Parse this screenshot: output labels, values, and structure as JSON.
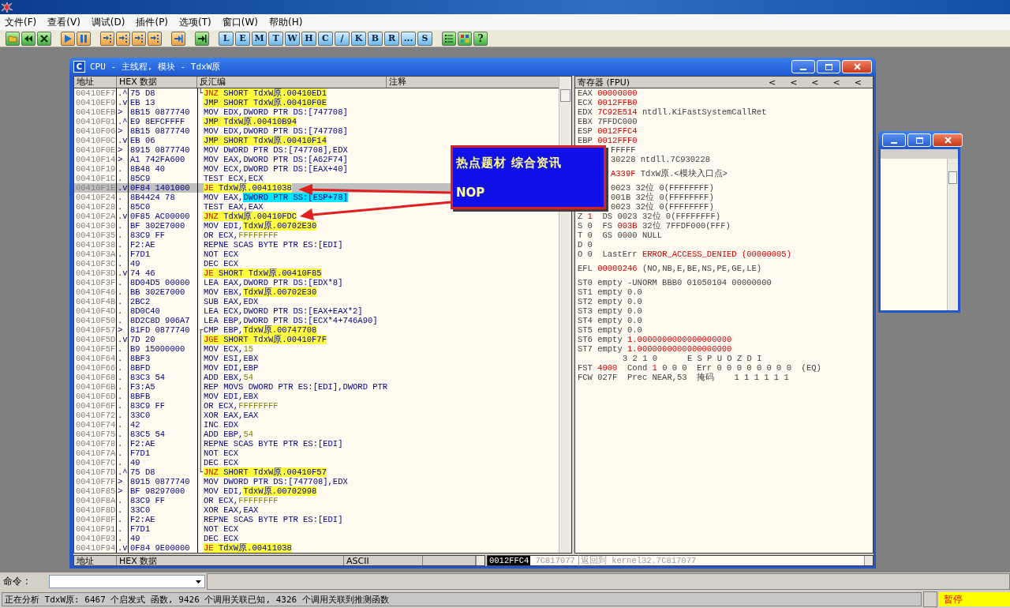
{
  "menu": [
    "文件(F)",
    "查看(V)",
    "调试(D)",
    "插件(P)",
    "选项(T)",
    "窗口(W)",
    "帮助(H)"
  ],
  "toolbar": {
    "letters": [
      "L",
      "E",
      "M",
      "T",
      "W",
      "H",
      "C",
      "/",
      "K",
      "B",
      "R",
      "...",
      "S"
    ],
    "help": "?"
  },
  "cpu_window": {
    "title": "CPU - 主线程, 模块 - TdxW原",
    "icon_letter": "C"
  },
  "disasm": {
    "columns": [
      "地址",
      "HEX 数据",
      "反汇编",
      "注释"
    ],
    "rows": [
      {
        "address": "00410EF7",
        "mark": ".^",
        "hex": "75 D8",
        "mnemonic": "JNZ",
        "kind": "jcc",
        "operands": [
          {
            "text": "SHORT TdxW原.00410ED1",
            "kind": "addr"
          }
        ],
        "selected": false,
        "bracket": "└"
      },
      {
        "address": "00410EF9",
        "mark": ".v",
        "hex": "EB 13",
        "mnemonic": "JMP",
        "kind": "jmp",
        "operands": [
          {
            "text": "SHORT TdxW原.00410F0E",
            "kind": "addr"
          }
        ],
        "selected": false
      },
      {
        "address": "00410EFB",
        "mark": ">",
        "hex": "8B15 0877740",
        "mnemonic": "MOV",
        "kind": "plain",
        "operands": [
          {
            "text": "EDX,DWORD PTR DS:[747708]",
            "kind": "plain"
          }
        ],
        "selected": false
      },
      {
        "address": "00410F01",
        "mark": ".^",
        "hex": "E9 8EFCFFFF",
        "mnemonic": "JMP",
        "kind": "jmp",
        "operands": [
          {
            "text": "TdxW原.00410B94",
            "kind": "addr"
          }
        ],
        "selected": false
      },
      {
        "address": "00410F06",
        "mark": ">",
        "hex": "8B15 0877740",
        "mnemonic": "MOV",
        "kind": "plain",
        "operands": [
          {
            "text": "EDX,DWORD PTR DS:[747708]",
            "kind": "plain"
          }
        ],
        "selected": false
      },
      {
        "address": "00410F0C",
        "mark": ".v",
        "hex": "EB 06",
        "mnemonic": "JMP",
        "kind": "jmp",
        "operands": [
          {
            "text": "SHORT TdxW原.00410F14",
            "kind": "addr"
          }
        ],
        "selected": false
      },
      {
        "address": "00410F0E",
        "mark": ">",
        "hex": "8915 0877740",
        "mnemonic": "MOV",
        "kind": "plain",
        "operands": [
          {
            "text": "DWORD PTR DS:[747708],EDX",
            "kind": "plain"
          }
        ],
        "selected": false
      },
      {
        "address": "00410F14",
        "mark": ">",
        "hex": "A1 742FA600",
        "mnemonic": "MOV",
        "kind": "plain",
        "operands": [
          {
            "text": "EAX,DWORD PTR DS:[A62F74]",
            "kind": "plain"
          }
        ],
        "selected": false
      },
      {
        "address": "00410F19",
        "mark": ".",
        "hex": "8B48 40",
        "mnemonic": "MOV",
        "kind": "plain",
        "operands": [
          {
            "text": "ECX,DWORD PTR DS:[EAX+40]",
            "kind": "plain"
          }
        ],
        "selected": false
      },
      {
        "address": "00410F1C",
        "mark": ".",
        "hex": "85C9",
        "mnemonic": "TEST",
        "kind": "plain",
        "operands": [
          {
            "text": "ECX,ECX",
            "kind": "plain"
          }
        ],
        "selected": false
      },
      {
        "address": "00410F1E",
        "mark": ".v",
        "hex": "0F84 1401000",
        "mnemonic": "JE",
        "kind": "jcc",
        "operands": [
          {
            "text": "TdxW原.00411038",
            "kind": "addr"
          }
        ],
        "selected": true
      },
      {
        "address": "00410F24",
        "mark": ".",
        "hex": "8B4424 78",
        "mnemonic": "MOV",
        "kind": "plain",
        "operands": [
          {
            "text": "EAX,",
            "kind": "plain"
          },
          {
            "text": "DWORD PTR SS:[ESP+78]",
            "kind": "stack"
          }
        ],
        "selected": false
      },
      {
        "address": "00410F28",
        "mark": ".",
        "hex": "85C0",
        "mnemonic": "TEST",
        "kind": "plain",
        "operands": [
          {
            "text": "EAX,EAX",
            "kind": "plain"
          }
        ],
        "selected": false
      },
      {
        "address": "00410F2A",
        "mark": ".v",
        "hex": "0F85 AC00000",
        "mnemonic": "JNZ",
        "kind": "jcc",
        "operands": [
          {
            "text": "TdxW原.00410FDC",
            "kind": "addr"
          }
        ],
        "selected": false
      },
      {
        "address": "00410F30",
        "mark": ".",
        "hex": "BF 302E7000",
        "mnemonic": "MOV",
        "kind": "plain",
        "operands": [
          {
            "text": "EDI,",
            "kind": "plain"
          },
          {
            "text": "TdxW原.00702E30",
            "kind": "addr"
          }
        ],
        "selected": false
      },
      {
        "address": "00410F35",
        "mark": ".",
        "hex": "83C9 FF",
        "mnemonic": "OR",
        "kind": "plain",
        "operands": [
          {
            "text": "ECX,",
            "kind": "plain"
          },
          {
            "text": "FFFFFFFF",
            "kind": "const"
          }
        ],
        "selected": false
      },
      {
        "address": "00410F38",
        "mark": ".",
        "hex": "F2:AE",
        "mnemonic": "REPNE",
        "kind": "plain",
        "operands": [
          {
            "text": "SCAS BYTE PTR ES:[EDI]",
            "kind": "plain"
          }
        ],
        "selected": false
      },
      {
        "address": "00410F3A",
        "mark": ".",
        "hex": "F7D1",
        "mnemonic": "NOT",
        "kind": "plain",
        "operands": [
          {
            "text": "ECX",
            "kind": "plain"
          }
        ],
        "selected": false
      },
      {
        "address": "00410F3C",
        "mark": ".",
        "hex": "49",
        "mnemonic": "DEC",
        "kind": "plain",
        "operands": [
          {
            "text": "ECX",
            "kind": "plain"
          }
        ],
        "selected": false
      },
      {
        "address": "00410F3D",
        "mark": ".v",
        "hex": "74 46",
        "mnemonic": "JE",
        "kind": "jcc",
        "operands": [
          {
            "text": "SHORT TdxW原.00410F85",
            "kind": "addr"
          }
        ],
        "selected": false
      },
      {
        "address": "00410F3F",
        "mark": ".",
        "hex": "8D04D5 00000",
        "mnemonic": "LEA",
        "kind": "plain",
        "operands": [
          {
            "text": "EAX,DWORD PTR DS:[EDX*8]",
            "kind": "plain"
          }
        ],
        "selected": false
      },
      {
        "address": "00410F46",
        "mark": ".",
        "hex": "BB 302E7000",
        "mnemonic": "MOV",
        "kind": "plain",
        "operands": [
          {
            "text": "EBX,",
            "kind": "plain"
          },
          {
            "text": "TdxW原.00702E30",
            "kind": "addr"
          }
        ],
        "selected": false
      },
      {
        "address": "00410F4B",
        "mark": ".",
        "hex": "2BC2",
        "mnemonic": "SUB",
        "kind": "plain",
        "operands": [
          {
            "text": "EAX,EDX",
            "kind": "plain"
          }
        ],
        "selected": false
      },
      {
        "address": "00410F4D",
        "mark": ".",
        "hex": "8D0C40",
        "mnemonic": "LEA",
        "kind": "plain",
        "operands": [
          {
            "text": "ECX,DWORD PTR DS:[EAX+EAX*2]",
            "kind": "plain"
          }
        ],
        "selected": false
      },
      {
        "address": "00410F50",
        "mark": ".",
        "hex": "8D2C8D 906A7",
        "mnemonic": "LEA",
        "kind": "plain",
        "operands": [
          {
            "text": "EBP,DWORD PTR DS:[ECX*4+746A90]",
            "kind": "plain"
          }
        ],
        "selected": false
      },
      {
        "address": "00410F57",
        "mark": ">",
        "hex": "81FD 0877740",
        "mnemonic": "CMP",
        "kind": "plain",
        "operands": [
          {
            "text": "EBP,",
            "kind": "plain"
          },
          {
            "text": "TdxW原.00747708",
            "kind": "addr"
          }
        ],
        "selected": false,
        "bracket": "┌"
      },
      {
        "address": "00410F5D",
        "mark": ".v",
        "hex": "7D 20",
        "mnemonic": "JGE",
        "kind": "jcc",
        "operands": [
          {
            "text": "SHORT TdxW原.00410F7F",
            "kind": "addr"
          }
        ],
        "selected": false,
        "bracket": "│"
      },
      {
        "address": "00410F5F",
        "mark": ".",
        "hex": "B9 15000000",
        "mnemonic": "MOV",
        "kind": "plain",
        "operands": [
          {
            "text": "ECX,",
            "kind": "plain"
          },
          {
            "text": "15",
            "kind": "const"
          }
        ],
        "selected": false,
        "bracket": "│"
      },
      {
        "address": "00410F64",
        "mark": ".",
        "hex": "8BF3",
        "mnemonic": "MOV",
        "kind": "plain",
        "operands": [
          {
            "text": "ESI,EBX",
            "kind": "plain"
          }
        ],
        "selected": false,
        "bracket": "│"
      },
      {
        "address": "00410F66",
        "mark": ".",
        "hex": "8BFD",
        "mnemonic": "MOV",
        "kind": "plain",
        "operands": [
          {
            "text": "EDI,EBP",
            "kind": "plain"
          }
        ],
        "selected": false,
        "bracket": "│"
      },
      {
        "address": "00410F68",
        "mark": ".",
        "hex": "83C3 54",
        "mnemonic": "ADD",
        "kind": "plain",
        "operands": [
          {
            "text": "EBX,",
            "kind": "plain"
          },
          {
            "text": "54",
            "kind": "const"
          }
        ],
        "selected": false,
        "bracket": "│"
      },
      {
        "address": "00410F6B",
        "mark": ".",
        "hex": "F3:A5",
        "mnemonic": "REP",
        "kind": "plain",
        "operands": [
          {
            "text": "MOVS DWORD PTR ES:[EDI],DWORD PTR",
            "kind": "plain"
          }
        ],
        "selected": false,
        "bracket": "│"
      },
      {
        "address": "00410F6D",
        "mark": ".",
        "hex": "8BFB",
        "mnemonic": "MOV",
        "kind": "plain",
        "operands": [
          {
            "text": "EDI,EBX",
            "kind": "plain"
          }
        ],
        "selected": false,
        "bracket": "│"
      },
      {
        "address": "00410F6F",
        "mark": ".",
        "hex": "83C9 FF",
        "mnemonic": "OR",
        "kind": "plain",
        "operands": [
          {
            "text": "ECX,",
            "kind": "plain"
          },
          {
            "text": "FFFFFFFF",
            "kind": "const"
          }
        ],
        "selected": false,
        "bracket": "│"
      },
      {
        "address": "00410F72",
        "mark": ".",
        "hex": "33C0",
        "mnemonic": "XOR",
        "kind": "plain",
        "operands": [
          {
            "text": "EAX,EAX",
            "kind": "plain"
          }
        ],
        "selected": false,
        "bracket": "│"
      },
      {
        "address": "00410F74",
        "mark": ".",
        "hex": "42",
        "mnemonic": "INC",
        "kind": "plain",
        "operands": [
          {
            "text": "EDX",
            "kind": "plain"
          }
        ],
        "selected": false,
        "bracket": "│"
      },
      {
        "address": "00410F75",
        "mark": ".",
        "hex": "83C5 54",
        "mnemonic": "ADD",
        "kind": "plain",
        "operands": [
          {
            "text": "EBP,",
            "kind": "plain"
          },
          {
            "text": "54",
            "kind": "const"
          }
        ],
        "selected": false,
        "bracket": "│"
      },
      {
        "address": "00410F78",
        "mark": ".",
        "hex": "F2:AE",
        "mnemonic": "REPNE",
        "kind": "plain",
        "operands": [
          {
            "text": "SCAS BYTE PTR ES:[EDI]",
            "kind": "plain"
          }
        ],
        "selected": false,
        "bracket": "│"
      },
      {
        "address": "00410F7A",
        "mark": ".",
        "hex": "F7D1",
        "mnemonic": "NOT",
        "kind": "plain",
        "operands": [
          {
            "text": "ECX",
            "kind": "plain"
          }
        ],
        "selected": false,
        "bracket": "│"
      },
      {
        "address": "00410F7C",
        "mark": ".",
        "hex": "49",
        "mnemonic": "DEC",
        "kind": "plain",
        "operands": [
          {
            "text": "ECX",
            "kind": "plain"
          }
        ],
        "selected": false,
        "bracket": "│"
      },
      {
        "address": "00410F7D",
        "mark": ".^",
        "hex": "75 D8",
        "mnemonic": "JNZ",
        "kind": "jcc",
        "operands": [
          {
            "text": "SHORT TdxW原.00410F57",
            "kind": "addr"
          }
        ],
        "selected": false,
        "bracket": "└"
      },
      {
        "address": "00410F7F",
        "mark": ">",
        "hex": "8915 0877740",
        "mnemonic": "MOV",
        "kind": "plain",
        "operands": [
          {
            "text": "DWORD PTR DS:[747708],EDX",
            "kind": "plain"
          }
        ],
        "selected": false
      },
      {
        "address": "00410F85",
        "mark": ">",
        "hex": "BF 98297000",
        "mnemonic": "MOV",
        "kind": "plain",
        "operands": [
          {
            "text": "EDI,",
            "kind": "plain"
          },
          {
            "text": "TdxW原.00702998",
            "kind": "addr"
          }
        ],
        "selected": false
      },
      {
        "address": "00410F8A",
        "mark": ".",
        "hex": "83C9 FF",
        "mnemonic": "OR",
        "kind": "plain",
        "operands": [
          {
            "text": "ECX,",
            "kind": "plain"
          },
          {
            "text": "FFFFFFFF",
            "kind": "const"
          }
        ],
        "selected": false
      },
      {
        "address": "00410F8D",
        "mark": ".",
        "hex": "33C0",
        "mnemonic": "XOR",
        "kind": "plain",
        "operands": [
          {
            "text": "EAX,EAX",
            "kind": "plain"
          }
        ],
        "selected": false
      },
      {
        "address": "00410F8F",
        "mark": ".",
        "hex": "F2:AE",
        "mnemonic": "REPNE",
        "kind": "plain",
        "operands": [
          {
            "text": "SCAS BYTE PTR ES:[EDI]",
            "kind": "plain"
          }
        ],
        "selected": false
      },
      {
        "address": "00410F91",
        "mark": ".",
        "hex": "F7D1",
        "mnemonic": "NOT",
        "kind": "plain",
        "operands": [
          {
            "text": "ECX",
            "kind": "plain"
          }
        ],
        "selected": false
      },
      {
        "address": "00410F93",
        "mark": ".",
        "hex": "49",
        "mnemonic": "DEC",
        "kind": "plain",
        "operands": [
          {
            "text": "ECX",
            "kind": "plain"
          }
        ],
        "selected": false
      },
      {
        "address": "00410F94",
        "mark": ".v",
        "hex": "0F84 9E00000",
        "mnemonic": "JE",
        "kind": "jcc",
        "operands": [
          {
            "text": "TdxW原.00411038",
            "kind": "addr"
          }
        ],
        "selected": false
      }
    ]
  },
  "registers": {
    "title": "寄存器 (FPU)",
    "arrows": [
      "<",
      "<",
      "<",
      "<",
      "<"
    ],
    "groups": [
      {
        "lines": [
          {
            "kind": "full",
            "parts": [
              {
                "text": "EAX ",
                "changed": false
              },
              {
                "text": "00000000",
                "changed": true
              }
            ]
          },
          {
            "kind": "full",
            "parts": [
              {
                "text": "ECX ",
                "changed": false
              },
              {
                "text": "0012FFB0",
                "changed": true
              }
            ]
          },
          {
            "kind": "full",
            "parts": [
              {
                "text": "EDX ",
                "changed": false
              },
              {
                "text": "7C92E514",
                "changed": true
              },
              {
                "text": " ntdll.KiFastSystemCallRet",
                "changed": false
              }
            ]
          },
          {
            "kind": "full",
            "parts": [
              {
                "text": "EBX 7FFDC000",
                "changed": false
              }
            ]
          },
          {
            "kind": "full",
            "parts": [
              {
                "text": "ESP ",
                "changed": false
              },
              {
                "text": "0012FFC4",
                "changed": true
              }
            ]
          },
          {
            "kind": "full",
            "parts": [
              {
                "text": "EBP ",
                "changed": false
              },
              {
                "text": "0012FFF0",
                "changed": true
              }
            ]
          },
          {
            "kind": "covered",
            "parts": [
              {
                "text": "FFFFF",
                "changed": false
              }
            ]
          },
          {
            "kind": "covered",
            "parts": [
              {
                "text": "30228 ntdll.7C930228",
                "changed": false
              }
            ]
          }
        ]
      },
      {
        "lines": [
          {
            "kind": "covered",
            "parts": [
              {
                "text": "A339F",
                "changed": true
              },
              {
                "text": " TdxW原.<模块入口点>",
                "changed": false
              }
            ]
          }
        ]
      },
      {
        "lines": [
          {
            "kind": "covered",
            "parts": [
              {
                "text": "0023 32位 0(FFFFFFFF)",
                "changed": false
              }
            ]
          },
          {
            "kind": "covered",
            "parts": [
              {
                "text": "001B 32位 0(FFFFFFFF)",
                "changed": false
              }
            ]
          },
          {
            "kind": "covered",
            "parts": [
              {
                "text": "0023 32位 0(FFFFFFFF)",
                "changed": false
              }
            ]
          },
          {
            "kind": "full",
            "parts": [
              {
                "text": "Z ",
                "changed": false
              },
              {
                "text": "1",
                "changed": true
              },
              {
                "text": "  DS 0023 32位 0(FFFFFFFF)",
                "changed": false
              }
            ]
          },
          {
            "kind": "full",
            "parts": [
              {
                "text": "S 0  FS ",
                "changed": false
              },
              {
                "text": "003B",
                "changed": true
              },
              {
                "text": " 32位 7FFDF000(FFF)",
                "changed": false
              }
            ]
          },
          {
            "kind": "full",
            "parts": [
              {
                "text": "T 0  GS 0000 NULL",
                "changed": false
              }
            ]
          },
          {
            "kind": "full",
            "parts": [
              {
                "text": "D 0",
                "changed": false
              }
            ]
          },
          {
            "kind": "full",
            "parts": [
              {
                "text": "O 0  LastErr ",
                "changed": false
              },
              {
                "text": "ERROR_ACCESS_DENIED (00000005)",
                "changed": true
              }
            ]
          }
        ]
      },
      {
        "lines": [
          {
            "kind": "full",
            "parts": [
              {
                "text": "EFL ",
                "changed": false
              },
              {
                "text": "00000246",
                "changed": true
              },
              {
                "text": " (NO,NB,E,BE,NS,PE,GE,LE)",
                "changed": false
              }
            ]
          }
        ]
      },
      {
        "lines": [
          {
            "kind": "full",
            "parts": [
              {
                "text": "ST0 empty -UNORM BBB0 01050104 00000000",
                "changed": false
              }
            ]
          },
          {
            "kind": "full",
            "parts": [
              {
                "text": "ST1 empty 0.0",
                "changed": false
              }
            ]
          },
          {
            "kind": "full",
            "parts": [
              {
                "text": "ST2 empty 0.0",
                "changed": false
              }
            ]
          },
          {
            "kind": "full",
            "parts": [
              {
                "text": "ST3 empty 0.0",
                "changed": false
              }
            ]
          },
          {
            "kind": "full",
            "parts": [
              {
                "text": "ST4 empty 0.0",
                "changed": false
              }
            ]
          },
          {
            "kind": "full",
            "parts": [
              {
                "text": "ST5 empty 0.0",
                "changed": false
              }
            ]
          },
          {
            "kind": "full",
            "parts": [
              {
                "text": "ST6 empty ",
                "changed": false
              },
              {
                "text": "1.0000000000000000000",
                "changed": true
              }
            ]
          },
          {
            "kind": "full",
            "parts": [
              {
                "text": "ST7 empty ",
                "changed": false
              },
              {
                "text": "1.0000000000000000000",
                "changed": true
              }
            ]
          },
          {
            "kind": "indent",
            "parts": [
              {
                "text": "3 2 1 0      E S P U O Z D I",
                "changed": false
              }
            ]
          },
          {
            "kind": "full",
            "parts": [
              {
                "text": "FST ",
                "changed": false
              },
              {
                "text": "4000",
                "changed": true
              },
              {
                "text": "  Cond ",
                "changed": false
              },
              {
                "text": "1",
                "changed": true
              },
              {
                "text": " 0 0 0  Err 0 0 0 0 0 0 0 0  (EQ)",
                "changed": false
              }
            ]
          },
          {
            "kind": "full",
            "parts": [
              {
                "text": "FCW 027F  Prec NEAR,53  掩码    1 1 1 1 1 1",
                "changed": false
              }
            ]
          }
        ]
      }
    ]
  },
  "popup": {
    "lines": [
      "热点题材 综合资讯",
      "NOP"
    ]
  },
  "dump_header": {
    "columns": [
      "地址",
      "HEX 数据",
      "ASCII"
    ]
  },
  "stack_row": {
    "address": "0012FFC4",
    "value": "7C817077",
    "comment": "返回到 kernel32.7C817077",
    "selected": true
  },
  "command": {
    "label": "命令 :"
  },
  "status": {
    "text": "正在分析 TdxW原: 6467 个启发式 函数, 9426 个调用关联已知, 4326 个调用关联到推测函数",
    "state": "暂停"
  }
}
